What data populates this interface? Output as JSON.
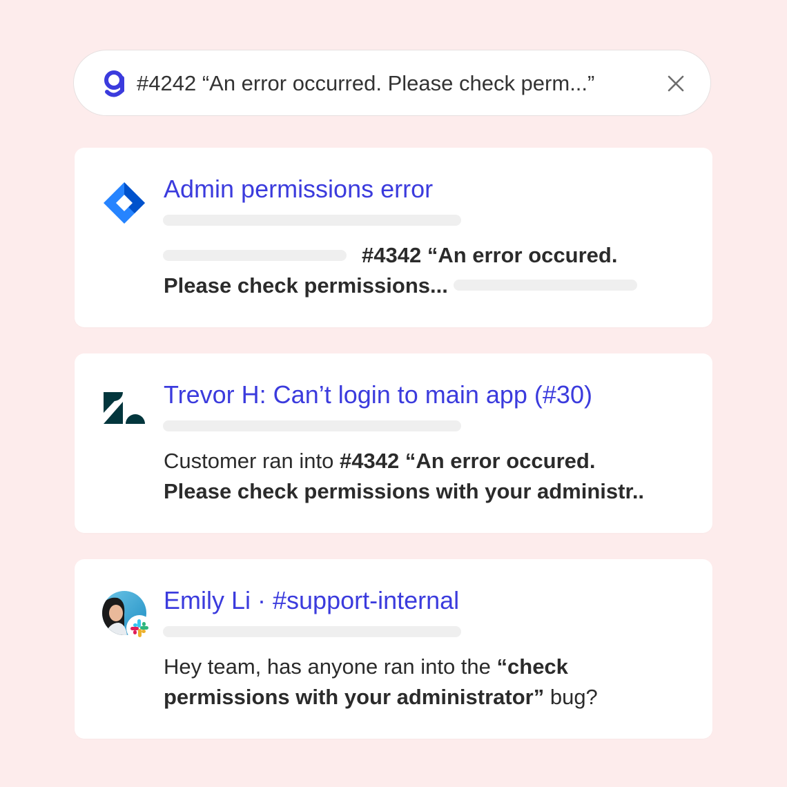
{
  "search": {
    "query": "#4242 “An error occurred. Please check perm...”",
    "logo_icon": "glean-logo-icon",
    "close_icon": "close-icon",
    "accent": "#3b3bdd"
  },
  "results": [
    {
      "source_icon": "jira-icon",
      "title": "Admin permissions error",
      "body_bold_1": "#4342 “An error occured.",
      "body_bold_2": "Please check permissions...",
      "body_prefix": ""
    },
    {
      "source_icon": "zendesk-icon",
      "title": "Trevor H: Can’t login to main app (#30)",
      "body_prefix": "Customer ran into ",
      "body_bold_1": "#4342 “An error occured.",
      "body_bold_2": "Please check permissions with your administr.."
    },
    {
      "source_icon": "slack-icon",
      "avatar": "avatar",
      "title": "Emily Li · #support-internal",
      "body_prefix": "Hey team, has anyone ran into the ",
      "body_bold_1": "“check",
      "body_bold_2": "permissions with your administrator”",
      "body_suffix": " bug?"
    }
  ],
  "colors": {
    "background": "#fdecec",
    "title": "#3b3bdd",
    "skeleton": "#efefef"
  }
}
